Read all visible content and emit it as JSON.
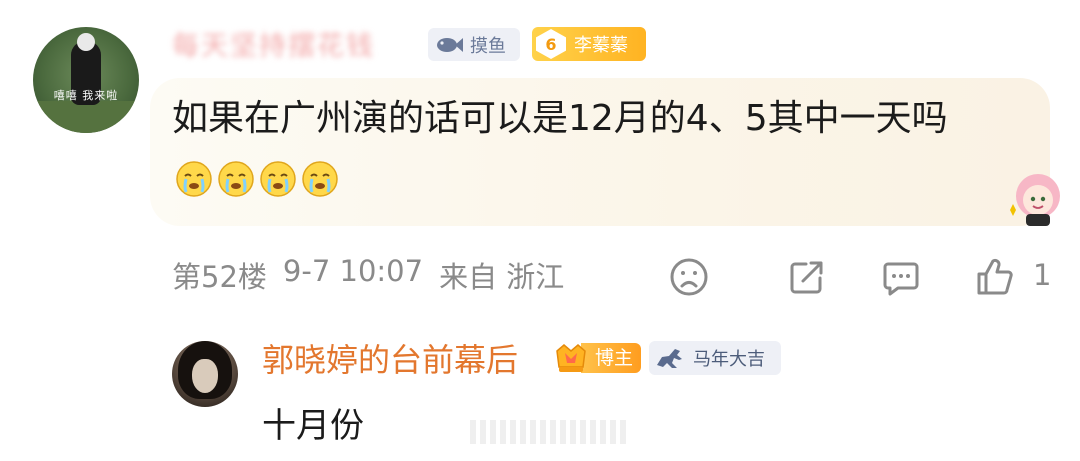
{
  "comment": {
    "author_name": "每天坚持摆花钱",
    "badge_fish": {
      "icon": "fish-icon",
      "label": "摸鱼"
    },
    "badge_rank": {
      "level": "6",
      "label": "李蓁蓁"
    },
    "avatar_caption": "嘻嘻 我来啦",
    "text": "如果在广州演的话可以是12月的4、5其中一天吗",
    "emoji": [
      "cry-emoji",
      "cry-emoji",
      "cry-emoji",
      "cry-emoji"
    ],
    "floor": "第52楼",
    "time": "9-7 10:07",
    "source": "来自 浙江",
    "actions": {
      "dislike_icon": "sad-face-icon",
      "share_icon": "share-icon",
      "reply_icon": "comment-icon",
      "like_icon": "thumbs-up-icon",
      "like_count": "1"
    }
  },
  "reply": {
    "author_name": "郭晓婷的台前幕后",
    "badge_blogger": {
      "icon": "crown-icon",
      "label": "博主"
    },
    "badge_horse": {
      "icon": "horse-icon",
      "label": "马年大吉"
    },
    "text": "十月份"
  },
  "colors": {
    "author_orange": "#e3772e",
    "meta_gray": "#8a8a8a",
    "rank_gold": "#ffb322"
  }
}
